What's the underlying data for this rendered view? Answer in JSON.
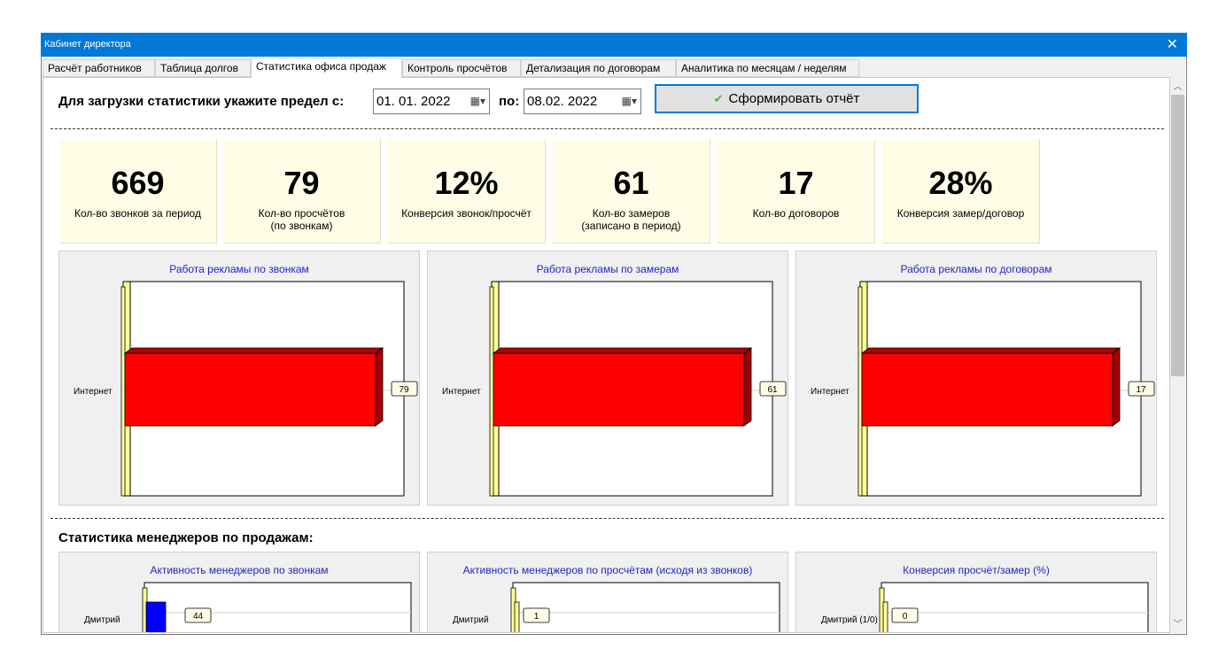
{
  "window": {
    "title": "Кабинет директора",
    "close_glyph": "✕"
  },
  "tabs": [
    {
      "label": "Расчёт работников",
      "active": false
    },
    {
      "label": "Таблица долгов",
      "active": false
    },
    {
      "label": "Статистика офиса продаж",
      "active": true
    },
    {
      "label": "Контроль просчётов",
      "active": false
    },
    {
      "label": "Детализация по договорам",
      "active": false
    },
    {
      "label": "Аналитика по месяцам / неделям",
      "active": false
    }
  ],
  "filter": {
    "label": "Для загрузки статистики укажите предел с:",
    "from_date": "01. 01. 2022",
    "to_label": "по:",
    "to_date": "08.02. 2022",
    "calendar_icon": "calendar-icon",
    "generate_label": "Сформировать отчёт",
    "generate_icon": "check-icon"
  },
  "kpis": [
    {
      "value": "669",
      "caption": "Кол-во звонков за период"
    },
    {
      "value": "79",
      "caption": "Кол-во просчётов\n(по звонкам)"
    },
    {
      "value": "12%",
      "caption": "Конверсия звонок/просчёт"
    },
    {
      "value": "61",
      "caption": "Кол-во замеров\n(записано в период)"
    },
    {
      "value": "17",
      "caption": "Кол-во договоров"
    },
    {
      "value": "28%",
      "caption": "Конверсия замер/договор"
    }
  ],
  "section2_title": "Статистика менеджеров по продажам:",
  "colors": {
    "accent": "#0078d7",
    "bar_red": "#ff0000",
    "bar_blue": "#0000ff",
    "wall_yellow": "#ffff99",
    "kpi_bg": "#fffde6",
    "chart_title": "#1f1fcc"
  },
  "chart_data": [
    {
      "type": "bar",
      "orientation": "horizontal",
      "title": "Работа рекламы по звонкам",
      "categories": [
        "Интернет"
      ],
      "values": [
        79
      ],
      "xlim": [
        0,
        79
      ]
    },
    {
      "type": "bar",
      "orientation": "horizontal",
      "title": "Работа рекламы по замерам",
      "categories": [
        "Интернет"
      ],
      "values": [
        61
      ],
      "xlim": [
        0,
        61
      ]
    },
    {
      "type": "bar",
      "orientation": "horizontal",
      "title": "Работа рекламы по договорам",
      "categories": [
        "Интернет"
      ],
      "values": [
        17
      ],
      "xlim": [
        0,
        17
      ]
    },
    {
      "type": "bar",
      "orientation": "horizontal",
      "title": "Активность менеджеров по звонкам",
      "categories": [
        "Дмитрий"
      ],
      "values": [
        44
      ]
    },
    {
      "type": "bar",
      "orientation": "horizontal",
      "title": "Активность менеджеров по просчётам (исходя из звонков)",
      "categories": [
        "Дмитрий"
      ],
      "values": [
        1
      ]
    },
    {
      "type": "bar",
      "orientation": "horizontal",
      "title": "Конверсия просчёт/замер (%)",
      "categories": [
        "Дмитрий (1/0)"
      ],
      "values": [
        0
      ]
    }
  ]
}
